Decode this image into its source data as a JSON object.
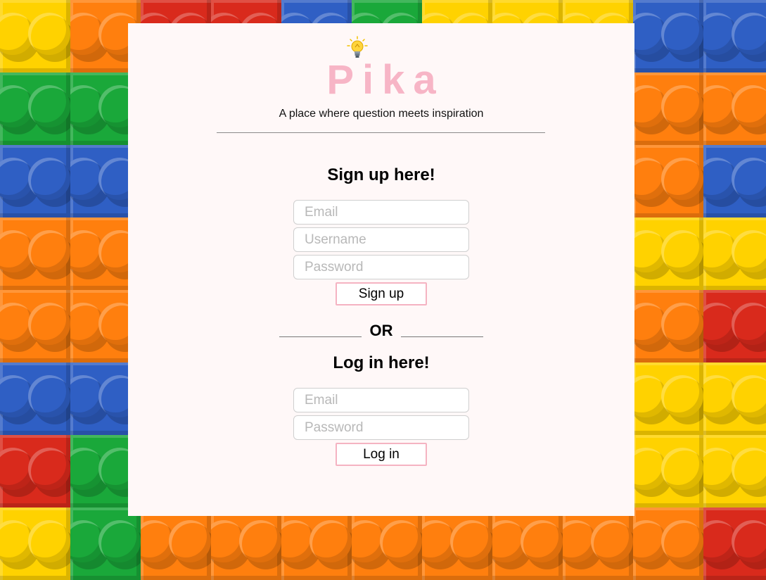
{
  "colors": {
    "logo_pink": "#f7b5c6",
    "button_border_pink": "#f5b3c2",
    "panel_bg": "#fff8f8",
    "lego_green": "#1aa83a",
    "lego_blue": "#2f5fc4",
    "lego_orange": "#ff7f0e",
    "lego_yellow": "#ffd200",
    "lego_red": "#d92a1c"
  },
  "header": {
    "logo_text": "Pika",
    "logo_icon": "lightbulb-icon",
    "tagline": "A place where question meets inspiration"
  },
  "signup": {
    "heading": "Sign up here!",
    "email_placeholder": "Email",
    "username_placeholder": "Username",
    "password_placeholder": "Password",
    "button_label": "Sign up"
  },
  "divider": {
    "text": "OR"
  },
  "login": {
    "heading": "Log in here!",
    "email_placeholder": "Email",
    "password_placeholder": "Password",
    "button_label": "Log in"
  }
}
